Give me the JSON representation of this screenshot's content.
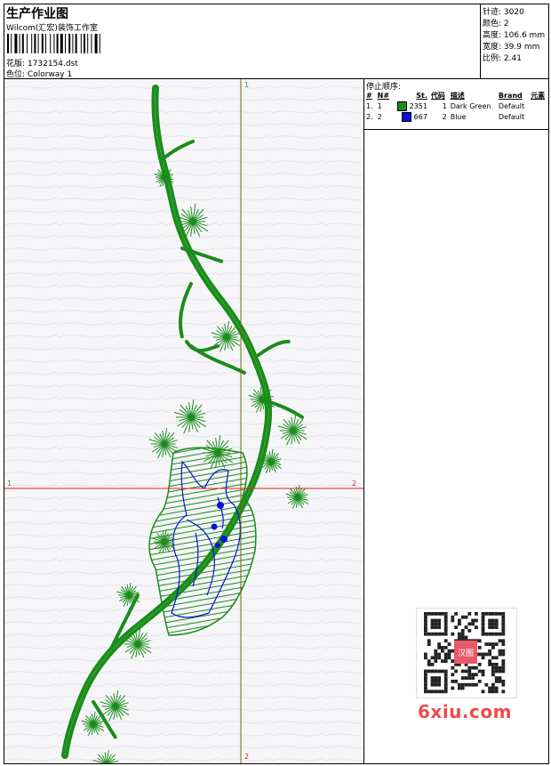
{
  "header": {
    "title": "生产作业图",
    "studio": "Wilcom(汇宏)装饰工作室",
    "design_label": "花版:",
    "design_file": "1732154.dst",
    "colorway_label": "色位:",
    "colorway": "Colorway 1"
  },
  "stats": [
    {
      "label": "针迹:",
      "value": "3020"
    },
    {
      "label": "颜色:",
      "value": "2"
    },
    {
      "label": "高度:",
      "value": "106.6 mm"
    },
    {
      "label": "宽度:",
      "value": "39.9 mm"
    },
    {
      "label": "比例:",
      "value": "2.41"
    }
  ],
  "stop_sequence": {
    "heading": "停止顺序:",
    "columns": [
      "#",
      "N#",
      "St.",
      "代码",
      "描述",
      "Brand",
      "元素"
    ],
    "rows": [
      {
        "num": "1.",
        "n": "1",
        "color": "#1a8c1a",
        "stitches": "2351",
        "code": "1",
        "desc": "Dark Green",
        "brand": "Default"
      },
      {
        "num": "2.",
        "n": "2",
        "color": "#0a10d8",
        "stitches": "667",
        "code": "2",
        "desc": "Blue",
        "brand": "Default"
      }
    ]
  },
  "axes": {
    "vertical_top": "1",
    "vertical_bottom": "2",
    "horizontal_left": "1",
    "horizontal_right": "2",
    "vertical_color": "#6b6b00",
    "horizontal_color": "#e02020"
  },
  "watermark": "6xiu.com",
  "qr_stamp": "汉图"
}
